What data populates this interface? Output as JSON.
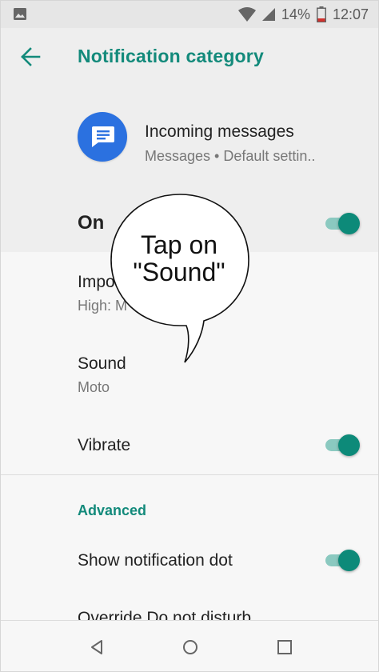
{
  "status": {
    "battery_percent": "14%",
    "time": "12:07"
  },
  "header": {
    "title": "Notification category",
    "app_name": "Incoming messages",
    "app_sub": "Messages • Default settin..",
    "on_label": "On",
    "on_state": true
  },
  "items": {
    "importance_title": "Impo",
    "importance_sub": "High: M",
    "sound_title": "Sound",
    "sound_sub": "Moto",
    "vibrate_title": "Vibrate",
    "vibrate_state": true
  },
  "advanced": {
    "label": "Advanced",
    "dot_title": "Show notification dot",
    "dot_state": true,
    "dnd_title": "Override Do not disturb"
  },
  "callout": {
    "line1": "Tap on",
    "line2": "\"Sound\""
  },
  "colors": {
    "accent": "#138a7b",
    "toggle_thumb": "#0d8a79",
    "toggle_track": "#8bc9c0",
    "app_icon": "#2b71e0"
  },
  "icons": {
    "status": [
      "gallery-icon",
      "wifi-icon",
      "signal-icon",
      "battery-icon"
    ],
    "nav": [
      "back-triangle-icon",
      "home-circle-icon",
      "recents-square-icon"
    ]
  }
}
